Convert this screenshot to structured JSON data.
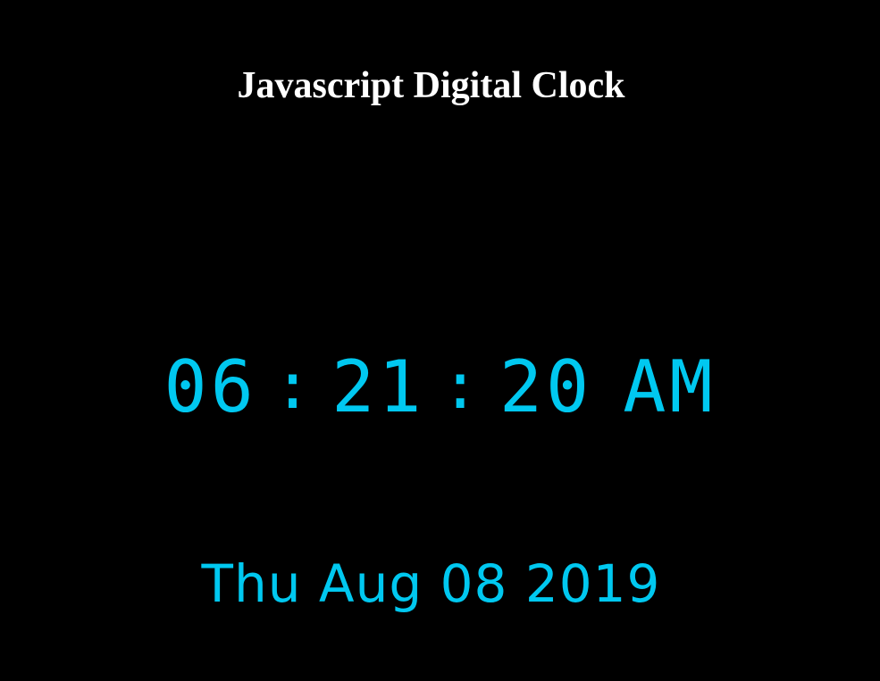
{
  "page": {
    "title": "Javascript Digital Clock",
    "background_color": "#000000",
    "accent_color": "#00c8f0"
  },
  "clock": {
    "hours": "06",
    "separator": ":",
    "minutes": "21",
    "seconds": "20",
    "period": "AM"
  },
  "date": {
    "text": "Thu Aug 08 2019"
  }
}
